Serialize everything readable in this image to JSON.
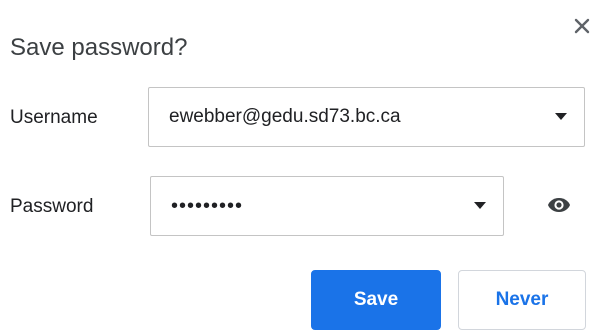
{
  "dialog": {
    "title": "Save password?",
    "close_icon": "close-icon"
  },
  "username": {
    "label": "Username",
    "value": "ewebber@gedu.sd73.bc.ca"
  },
  "password": {
    "label": "Password",
    "value": "•••••••••",
    "reveal_icon": "eye-icon"
  },
  "actions": {
    "save_label": "Save",
    "never_label": "Never"
  },
  "colors": {
    "accent": "#1a73e8",
    "text": "#202124",
    "border": "#c4c4c4"
  }
}
